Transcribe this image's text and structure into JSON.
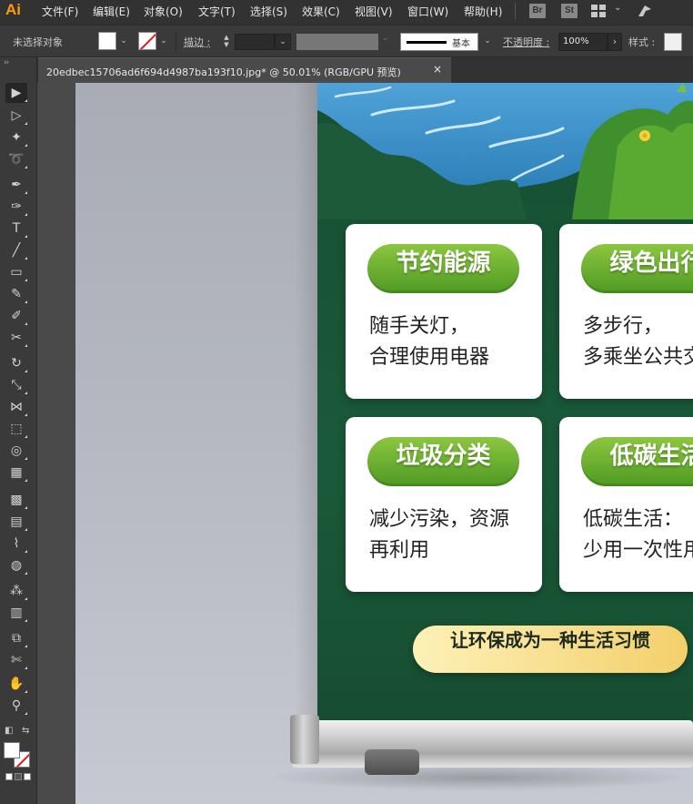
{
  "app": {
    "logo": "Ai"
  },
  "menubar": {
    "items": [
      "文件(F)",
      "编辑(E)",
      "对象(O)",
      "文字(T)",
      "选择(S)",
      "效果(C)",
      "视图(V)",
      "窗口(W)",
      "帮助(H)"
    ],
    "bridge_label": "Br",
    "stock_label": "St"
  },
  "controlbar": {
    "selection_status": "未选择对象",
    "stroke_label": "描边 :",
    "brush_label": "基本",
    "opacity_label": "不透明度 :",
    "opacity_value": "100%",
    "style_label": "样式 :"
  },
  "document": {
    "tab_title": "20edbec15706ad6f694d4987ba193f10.jpg* @ 50.01% (RGB/GPU 预览)",
    "tab_close": "×"
  },
  "poster": {
    "cards": [
      {
        "title": "节约能源",
        "body": "随手关灯，\n合理使用电器"
      },
      {
        "title": "绿色出行",
        "body": "多步行，\n多乘坐公共交通"
      },
      {
        "title": "垃圾分类",
        "body": "减少污染，资源\n再利用"
      },
      {
        "title": "低碳生活",
        "body": "低碳生活：\n少用一次性用品"
      }
    ],
    "slogan": "让环保成为一种生活习惯",
    "colors": {
      "background": "#1a5a3a",
      "pill": "#6fb130",
      "slogan": "#f4cf6b"
    }
  },
  "tools": [
    {
      "name": "selection-tool",
      "glyph": "▶"
    },
    {
      "name": "direct-selection-tool",
      "glyph": "▷"
    },
    {
      "name": "magic-wand-tool",
      "glyph": "✦"
    },
    {
      "name": "lasso-tool",
      "glyph": "➰"
    },
    {
      "name": "pen-tool",
      "glyph": "✒"
    },
    {
      "name": "curvature-tool",
      "glyph": "✑"
    },
    {
      "name": "type-tool",
      "glyph": "T"
    },
    {
      "name": "line-segment-tool",
      "glyph": "╱"
    },
    {
      "name": "rectangle-tool",
      "glyph": "▭"
    },
    {
      "name": "paintbrush-tool",
      "glyph": "✎"
    },
    {
      "name": "shaper-tool",
      "glyph": "✐"
    },
    {
      "name": "scissors-tool",
      "glyph": "✂"
    },
    {
      "name": "rotate-tool",
      "glyph": "↻"
    },
    {
      "name": "scale-tool",
      "glyph": "⤡"
    },
    {
      "name": "width-tool",
      "glyph": "⋈"
    },
    {
      "name": "free-transform-tool",
      "glyph": "⬚"
    },
    {
      "name": "shape-builder-tool",
      "glyph": "◎"
    },
    {
      "name": "perspective-grid-tool",
      "glyph": "▦"
    },
    {
      "name": "mesh-tool",
      "glyph": "▩"
    },
    {
      "name": "gradient-tool",
      "glyph": "▤"
    },
    {
      "name": "eyedropper-tool",
      "glyph": "⌇"
    },
    {
      "name": "blend-tool",
      "glyph": "◍"
    },
    {
      "name": "symbol-sprayer-tool",
      "glyph": "⁂"
    },
    {
      "name": "column-graph-tool",
      "glyph": "▥"
    },
    {
      "name": "artboard-tool",
      "glyph": "⧉"
    },
    {
      "name": "slice-tool",
      "glyph": "✄"
    },
    {
      "name": "hand-tool",
      "glyph": "✋"
    },
    {
      "name": "zoom-tool",
      "glyph": "⚲"
    }
  ]
}
